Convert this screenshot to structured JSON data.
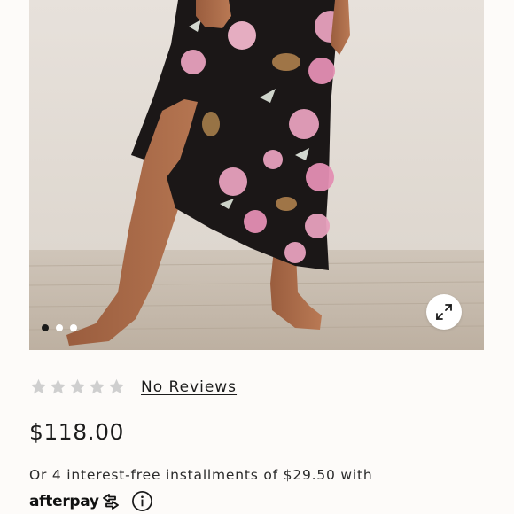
{
  "gallery": {
    "dot_count": 3,
    "active_dot": 0,
    "expand_icon": "expand-arrows-icon"
  },
  "rating": {
    "stars_filled": 0,
    "stars_total": 5,
    "star_color": "#c9c9c9",
    "reviews_label": "No Reviews"
  },
  "price": "$118.00",
  "installments": {
    "text": "Or 4 interest-free installments of $29.50 with",
    "provider": "afterpay",
    "info_icon": "info-icon"
  }
}
